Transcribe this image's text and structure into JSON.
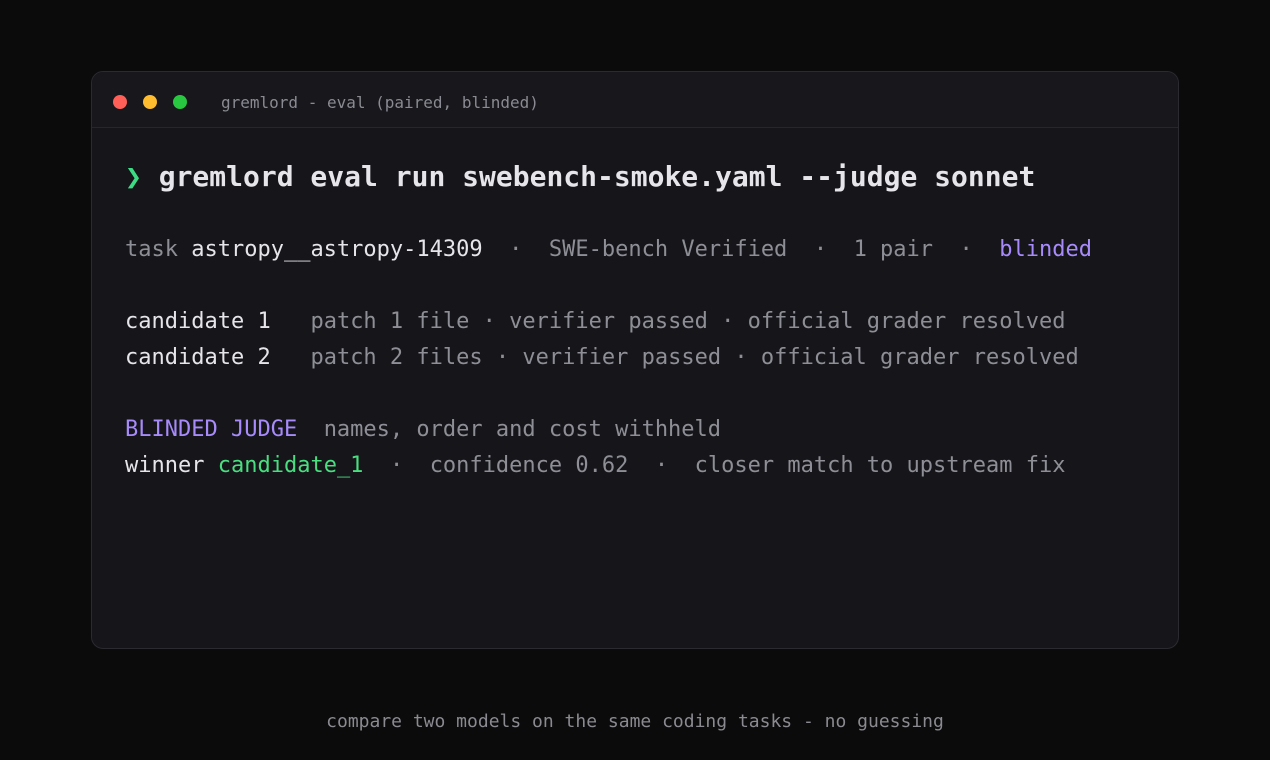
{
  "window": {
    "title": "gremlord - eval (paired, blinded)",
    "controls": {
      "close_color": "#ff5f57",
      "minimize_color": "#febc2e",
      "maximize_color": "#28c840"
    }
  },
  "command": {
    "prompt_symbol": "❯",
    "text": "gremlord eval run swebench-smoke.yaml --judge sonnet"
  },
  "task_line": {
    "label": "task",
    "task_id": "astropy__astropy-14309",
    "separator": "·",
    "dataset": "SWE-bench Verified",
    "pairs": "1 pair",
    "mode": "blinded"
  },
  "candidates": [
    {
      "name": "candidate 1",
      "patch": "patch 1 file",
      "verifier": "verifier passed",
      "grader": "official grader resolved"
    },
    {
      "name": "candidate 2",
      "patch": "patch 2 files",
      "verifier": "verifier passed",
      "grader": "official grader resolved"
    }
  ],
  "judge": {
    "heading": "BLINDED JUDGE",
    "note": "names, order and cost withheld",
    "winner_label": "winner",
    "winner": "candidate_1",
    "confidence": "confidence 0.62",
    "reason": "closer match to upstream fix"
  },
  "caption": "compare two models on the same coding tasks - no guessing",
  "colors": {
    "background": "#0b0b0c",
    "window_bg": "#15151a",
    "prompt": "#3ddc84",
    "accent_purple": "#a78bfa",
    "accent_green": "#4ade80",
    "text_bright": "#e6e6ea",
    "text_muted": "#8e8e96"
  }
}
